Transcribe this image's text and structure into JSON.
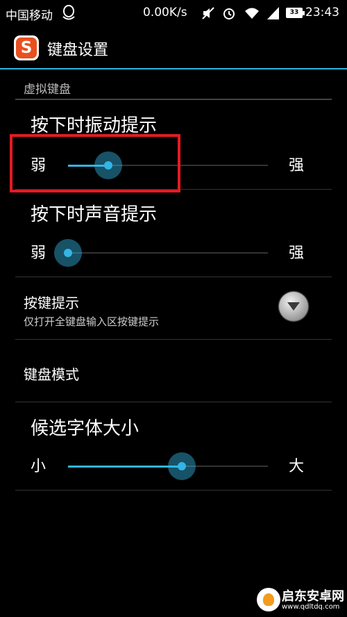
{
  "status_bar": {
    "carrier": "中国移动",
    "network_speed": "0.00K/s",
    "battery": "33",
    "time": "23:43",
    "icons": [
      "qq-icon",
      "mute-icon",
      "alarm-icon",
      "wifi-icon",
      "signal-icon",
      "battery-icon"
    ]
  },
  "action_bar": {
    "app_icon": "sogou-input-icon",
    "app_icon_letter": "S",
    "title": "键盘设置"
  },
  "section": {
    "header": "虚拟键盘"
  },
  "vibration": {
    "title": "按下时振动提示",
    "min_label": "弱",
    "max_label": "强",
    "level": 0.2
  },
  "sound": {
    "title": "按下时声音提示",
    "min_label": "弱",
    "max_label": "强",
    "level": 0.0
  },
  "key_hint": {
    "title": "按键提示",
    "summary": "仅打开全键盘输入区按键提示"
  },
  "keyboard_mode": {
    "title": "键盘模式"
  },
  "font_size": {
    "title": "候选字体大小",
    "min_label": "小",
    "max_label": "大",
    "level": 0.57
  },
  "watermark": {
    "name": "启东安卓网",
    "url": "www.qdltdq.com"
  },
  "colors": {
    "accent": "#33b5e5",
    "highlight": "#e21b23"
  }
}
